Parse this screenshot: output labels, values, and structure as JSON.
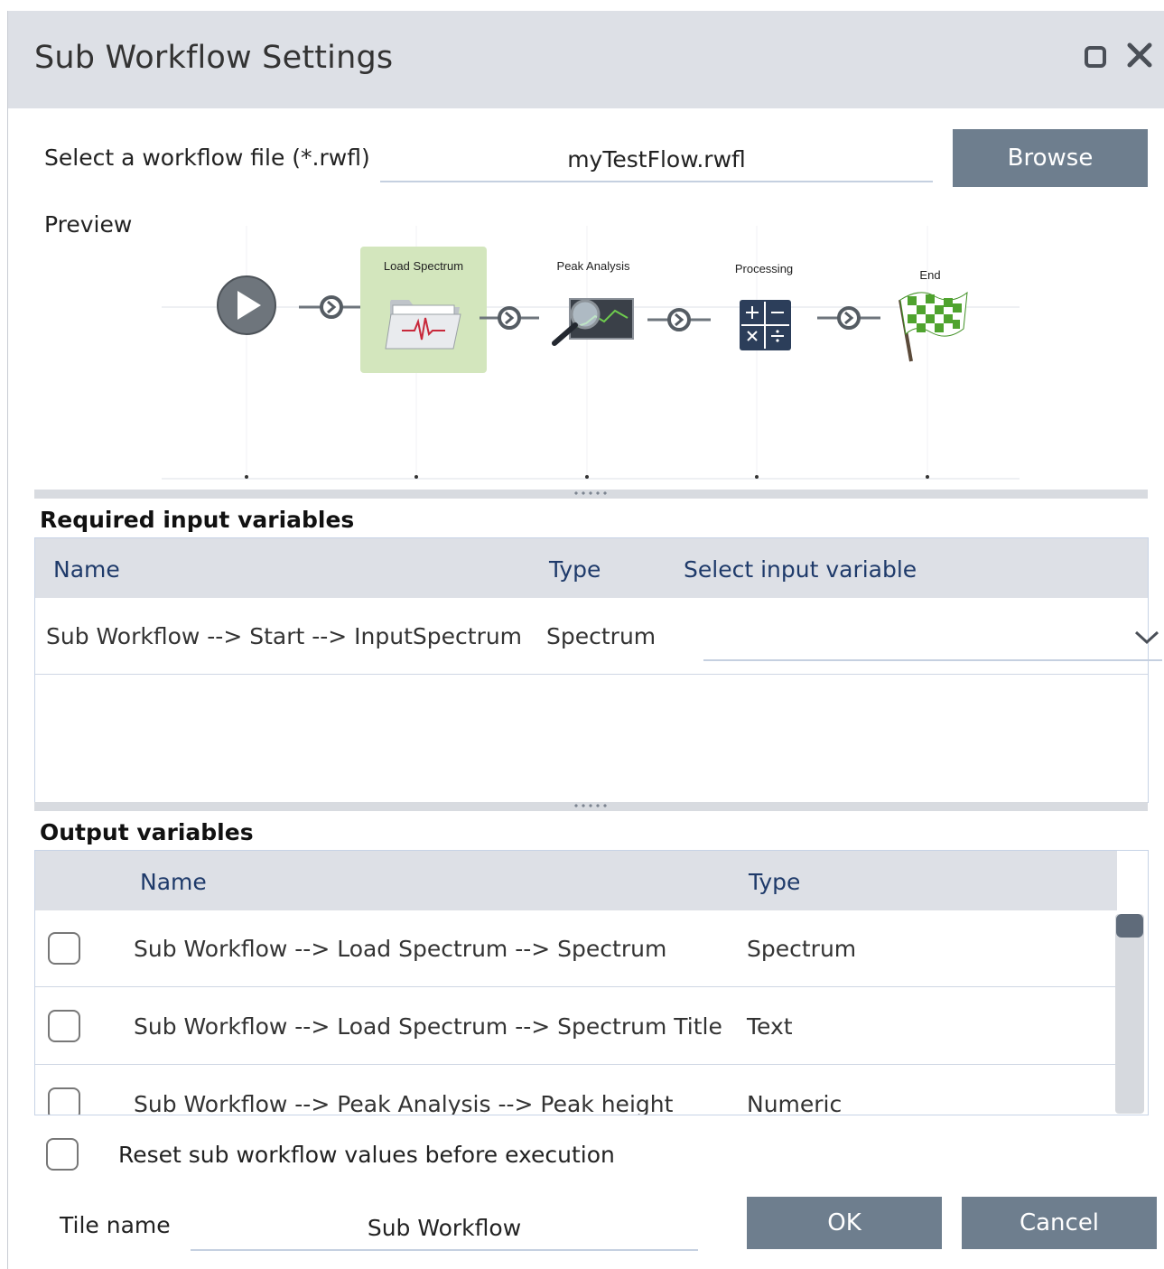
{
  "window": {
    "title": "Sub Workflow Settings",
    "restore_icon": "restore-icon",
    "close_icon": "close-icon"
  },
  "file_select": {
    "label": "Select a workflow file (*.rwfl)",
    "value": "myTestFlow.rwfl",
    "browse_label": "Browse"
  },
  "preview": {
    "label": "Preview",
    "nodes": [
      {
        "label": "",
        "icon": "start-play-icon",
        "selected": false
      },
      {
        "label": "Load Spectrum",
        "icon": "load-spectrum-folder-icon",
        "selected": true
      },
      {
        "label": "Peak Analysis",
        "icon": "peak-analysis-magnifier-icon",
        "selected": false
      },
      {
        "label": "Processing",
        "icon": "calculator-icon",
        "selected": false
      },
      {
        "label": "End",
        "icon": "checkered-flag-icon",
        "selected": false
      }
    ]
  },
  "required_inputs": {
    "section_title": "Required input variables",
    "columns": {
      "name": "Name",
      "type": "Type",
      "select": "Select input variable"
    },
    "rows": [
      {
        "name": "Sub Workflow --> Start --> InputSpectrum",
        "type": "Spectrum",
        "selected_value": ""
      }
    ]
  },
  "outputs": {
    "section_title": "Output variables",
    "columns": {
      "name": "Name",
      "type": "Type"
    },
    "rows": [
      {
        "checked": false,
        "name": "Sub Workflow --> Load Spectrum --> Spectrum",
        "type": "Spectrum"
      },
      {
        "checked": false,
        "name": "Sub Workflow --> Load Spectrum --> Spectrum Title",
        "type": "Text"
      },
      {
        "checked": false,
        "name": "Sub Workflow --> Peak Analysis --> Peak height",
        "type": "Numeric"
      }
    ]
  },
  "reset_option": {
    "label": "Reset sub workflow values before execution",
    "checked": false
  },
  "tile": {
    "label": "Tile name",
    "value": "Sub Workflow"
  },
  "actions": {
    "ok_label": "OK",
    "cancel_label": "Cancel"
  },
  "colors": {
    "titlebar": "#dde0e6",
    "button": "#6e7e8e",
    "header_text": "#1e3a6a",
    "selected_node": "#d3e6bd"
  }
}
